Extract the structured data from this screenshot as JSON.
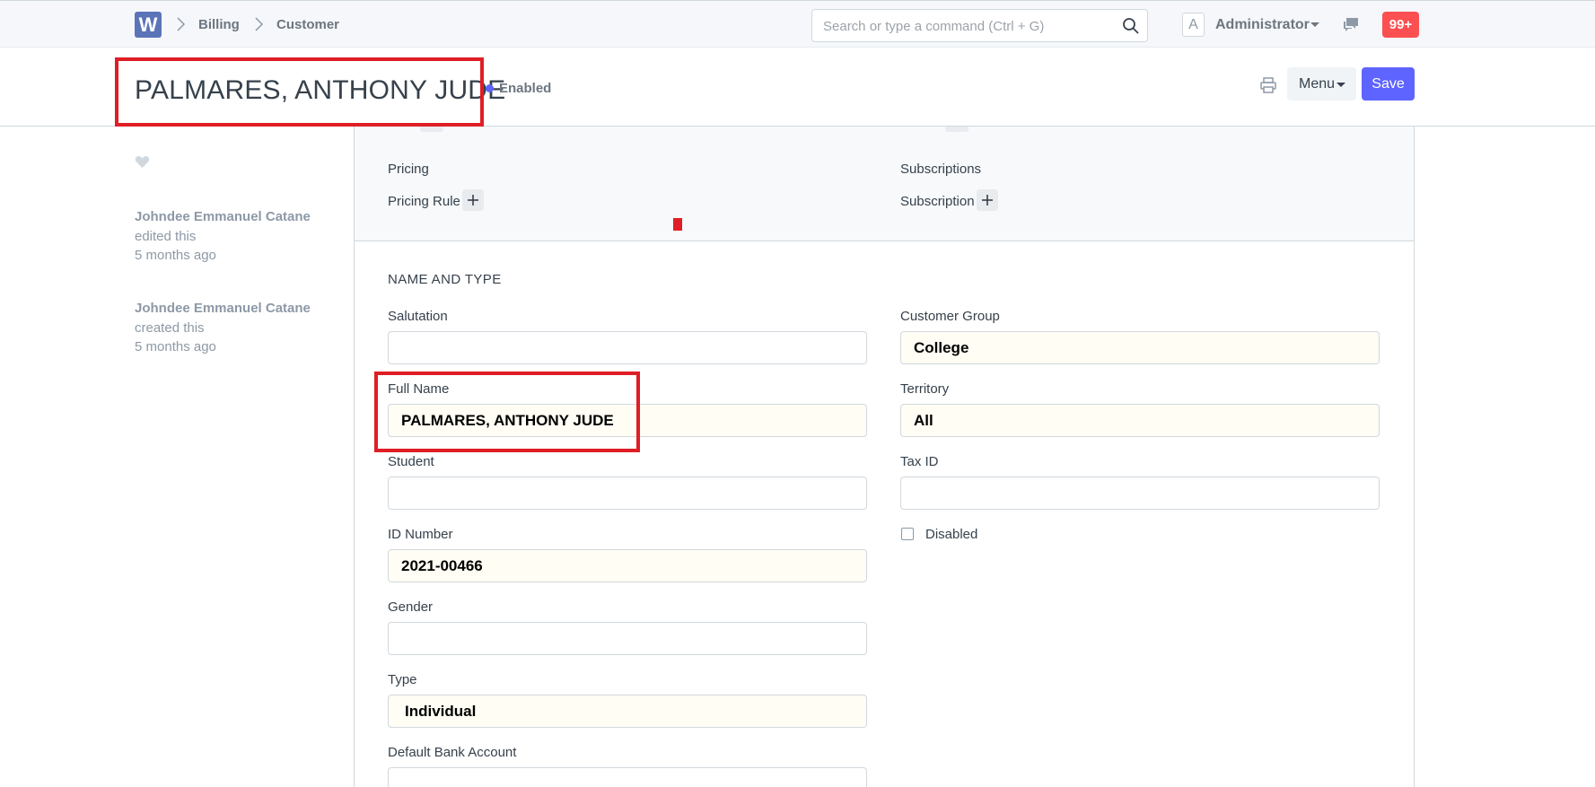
{
  "navbar": {
    "logo_letter": "W",
    "breadcrumbs": [
      "Billing",
      "Customer"
    ],
    "search_placeholder": "Search or type a command (Ctrl + G)",
    "avatar_letter": "A",
    "user_name": "Administrator",
    "notification_count": "99+"
  },
  "page_head": {
    "title": "PALMARES, ANTHONY JUDE",
    "status": "Enabled",
    "menu_label": "Menu",
    "save_label": "Save"
  },
  "sidebar": {
    "activity": [
      {
        "user": "Johndee Emmanuel Catane",
        "action": "edited this",
        "time": "5 months ago"
      },
      {
        "user": "Johndee Emmanuel Catane",
        "action": "created this",
        "time": "5 months ago"
      }
    ]
  },
  "dashboard": {
    "left": {
      "heading": "Pricing",
      "link": "Pricing Rule"
    },
    "right": {
      "heading": "Subscriptions",
      "link": "Subscription"
    }
  },
  "form": {
    "section_title": "NAME AND TYPE",
    "fields": {
      "salutation": {
        "label": "Salutation",
        "value": ""
      },
      "full_name": {
        "label": "Full Name",
        "value": "PALMARES, ANTHONY JUDE"
      },
      "student": {
        "label": "Student",
        "value": ""
      },
      "id_number": {
        "label": "ID Number",
        "value": "2021-00466"
      },
      "gender": {
        "label": "Gender",
        "value": ""
      },
      "type": {
        "label": "Type",
        "value": "Individual"
      },
      "default_bank_account": {
        "label": "Default Bank Account",
        "value": ""
      },
      "customer_group": {
        "label": "Customer Group",
        "value": "College"
      },
      "territory": {
        "label": "Territory",
        "value": "All"
      },
      "tax_id": {
        "label": "Tax ID",
        "value": ""
      },
      "disabled": {
        "label": "Disabled",
        "checked": false
      }
    }
  },
  "colors": {
    "primary": "#5e64ff",
    "highlight_box": "#e01e25",
    "notification": "#fc4f51"
  }
}
